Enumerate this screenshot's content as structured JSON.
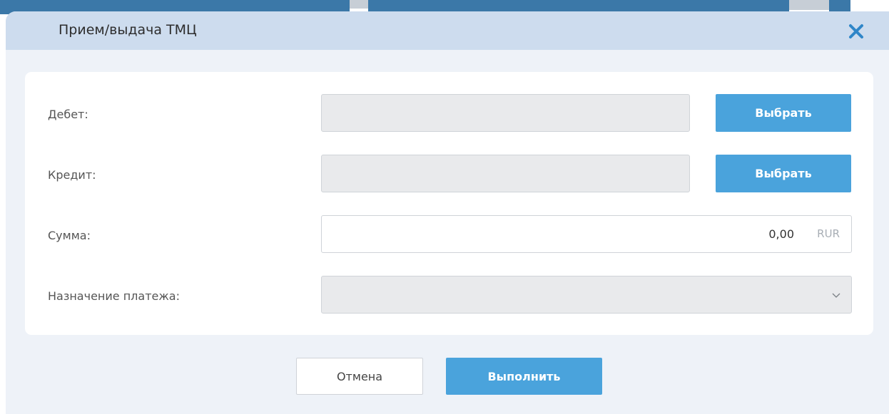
{
  "dialog": {
    "title": "Прием/выдача ТМЦ",
    "close_icon": "close-icon"
  },
  "form": {
    "debit": {
      "label": "Дебет:",
      "value": "",
      "button_label": "Выбрать"
    },
    "credit": {
      "label": "Кредит:",
      "value": "",
      "button_label": "Выбрать"
    },
    "amount": {
      "label": "Сумма:",
      "value": "0,00",
      "currency": "RUR"
    },
    "purpose": {
      "label": "Назначение платежа:",
      "value": "",
      "icon": "chevron-down-icon"
    }
  },
  "footer": {
    "cancel_label": "Отмена",
    "submit_label": "Выполнить"
  },
  "colors": {
    "accent": "#4aa3dc",
    "header_bg": "#cddcee",
    "dialog_bg": "#eef2f8",
    "close_icon": "#2f86c8"
  }
}
